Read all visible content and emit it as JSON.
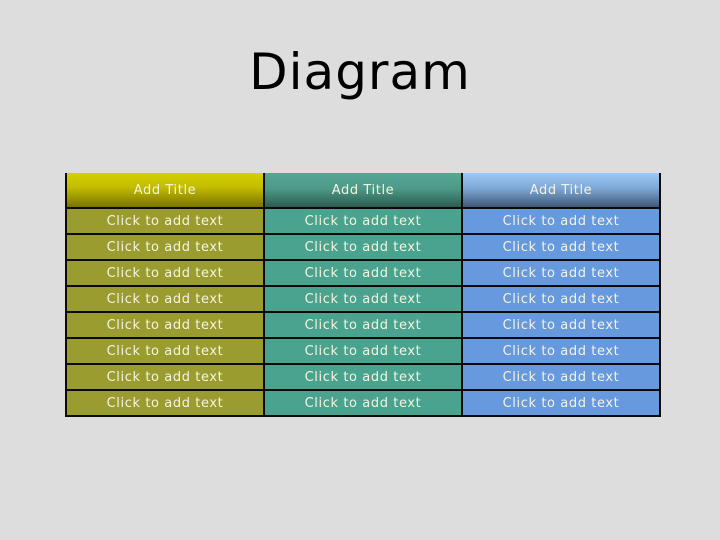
{
  "slide": {
    "title": "Diagram"
  },
  "colors": {
    "background": "#dddddd",
    "column_1": "#9a9c30",
    "column_2": "#4aa38e",
    "column_3": "#6699dd",
    "border": "#0a0a0a"
  },
  "table": {
    "headers": [
      "Add Title",
      "Add Title",
      "Add Title"
    ],
    "rows": [
      [
        "Click to add text",
        "Click to add text",
        "Click to add text"
      ],
      [
        "Click to add text",
        "Click to add text",
        "Click to add text"
      ],
      [
        "Click to add text",
        "Click to add text",
        "Click to add text"
      ],
      [
        "Click to add text",
        "Click to add text",
        "Click to add text"
      ],
      [
        "Click to add text",
        "Click to add text",
        "Click to add text"
      ],
      [
        "Click to add text",
        "Click to add text",
        "Click to add text"
      ],
      [
        "Click to add text",
        "Click to add text",
        "Click to add text"
      ],
      [
        "Click to add text",
        "Click to add text",
        "Click to add text"
      ]
    ]
  }
}
